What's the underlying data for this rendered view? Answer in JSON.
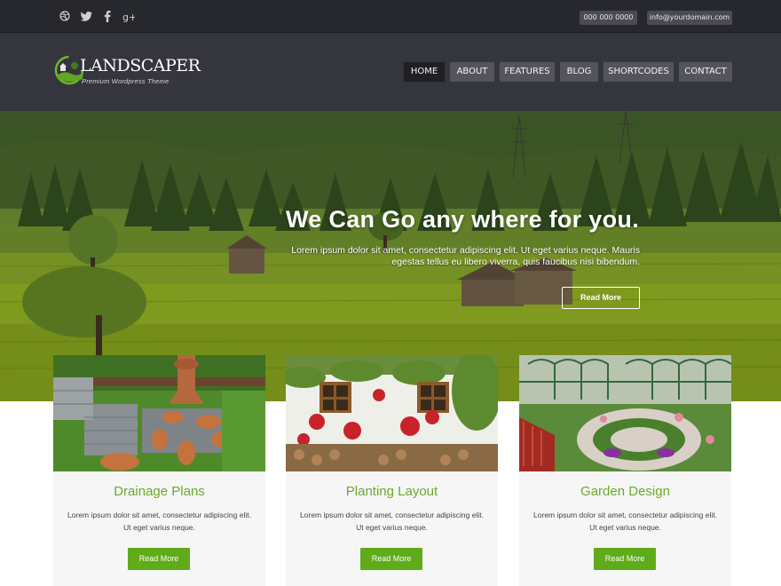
{
  "topbar": {
    "social_icons": [
      "dribbble-icon",
      "twitter-icon",
      "facebook-icon",
      "google-plus-icon"
    ],
    "phone": "000 000 0000",
    "email": "info@yourdomain.com"
  },
  "brand": {
    "title": "LANDSCAPER",
    "subtitle": "Premium Wordpress Theme"
  },
  "nav": {
    "items": [
      {
        "label": "HOME",
        "active": true
      },
      {
        "label": "ABOUT",
        "active": false
      },
      {
        "label": "FEATURES",
        "active": false
      },
      {
        "label": "BLOG",
        "active": false
      },
      {
        "label": "SHORTCODES",
        "active": false
      },
      {
        "label": "CONTACT",
        "active": false
      }
    ]
  },
  "hero": {
    "title": "We Can Go any where for you.",
    "text": "Lorem ipsum dolor sit amet, consectetur adipiscing elit. Ut eget varius neque. Mauris egestas tellus eu libero viverra, quis faucibus nisi bibendum.",
    "button": "Read More"
  },
  "cards": [
    {
      "title": "Drainage Plans",
      "text": "Lorem ipsum dolor sit amet, consectetur adipiscing elit. Ut eget varius neque.",
      "button": "Read More"
    },
    {
      "title": "Planting Layout",
      "text": "Lorem ipsum dolor sit amet, consectetur adipiscing elit. Ut eget varius neque.",
      "button": "Read More"
    },
    {
      "title": "Garden Design",
      "text": "Lorem ipsum dolor sit amet, consectetur adipiscing elit. Ut eget varius neque.",
      "button": "Read More"
    }
  ],
  "colors": {
    "accent": "#5fab19",
    "title_green": "#6aaa2a",
    "topbar": "#27282d",
    "header": "#34353d",
    "nav_active": "#1f2024",
    "nav_item": "#54555c"
  }
}
